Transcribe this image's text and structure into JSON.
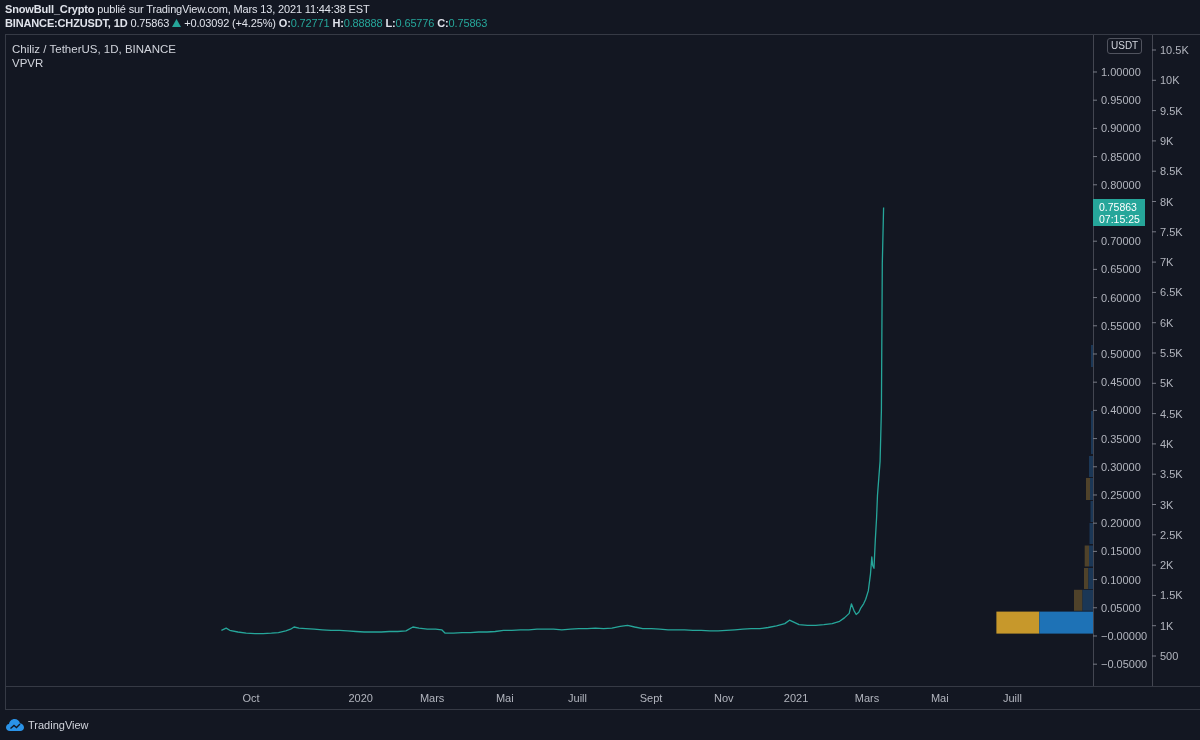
{
  "header": {
    "publisher": "**SnowBull_Crypto** publié sur TradingView.com, Mars 13, 2021 11:44:38 EST",
    "symbol": "BINANCE:CHZUSDT, 1D",
    "last": "0.75863",
    "rising": true,
    "change": "+0.03092 (+4.25%)",
    "ohlc": [
      {
        "label": "O:",
        "value": "0.72771"
      },
      {
        "label": "H:",
        "value": "0.88888"
      },
      {
        "label": "L:",
        "value": "0.65776"
      },
      {
        "label": "C:",
        "value": "0.75863"
      }
    ]
  },
  "legend": {
    "title": "Chiliz / TetherUS, 1D, BINANCE",
    "indicators": [
      "VPVR"
    ]
  },
  "price_chart": {
    "currency": "USDT",
    "last_price": {
      "value": "0.75863",
      "countdown": "07:15:25"
    },
    "chart_data": {
      "type": "line",
      "x": [
        2019.68,
        2019.691,
        2019.699,
        2019.718,
        2019.737,
        2019.757,
        2019.776,
        2019.795,
        2019.811,
        2019.828,
        2019.839,
        2019.847,
        2019.858,
        2019.874,
        2019.893,
        2019.912,
        2019.932,
        2019.951,
        2019.97,
        2019.989,
        2020.008,
        2020.027,
        2020.047,
        2020.066,
        2020.085,
        2020.104,
        2020.12,
        2020.134,
        2020.153,
        2020.172,
        2020.186,
        2020.194,
        2020.213,
        2020.233,
        2020.252,
        2020.271,
        2020.29,
        2020.309,
        2020.328,
        2020.347,
        2020.367,
        2020.386,
        2020.405,
        2020.424,
        2020.443,
        2020.462,
        2020.482,
        2020.501,
        2020.52,
        2020.539,
        2020.558,
        2020.577,
        2020.596,
        2020.613,
        2020.629,
        2020.648,
        2020.668,
        2020.687,
        2020.706,
        2020.725,
        2020.744,
        2020.763,
        2020.782,
        2020.802,
        2020.821,
        2020.84,
        2020.859,
        2020.878,
        2020.897,
        2020.917,
        2020.936,
        2020.955,
        2020.974,
        2020.985,
        2020.996,
        2021.007,
        2021.026,
        2021.045,
        2021.064,
        2021.083,
        2021.1,
        2021.111,
        2021.122,
        2021.127,
        2021.133,
        2021.138,
        2021.144,
        2021.149,
        2021.155,
        2021.16,
        2021.166,
        2021.171,
        2021.174,
        2021.176,
        2021.179,
        2021.182,
        2021.185,
        2021.187,
        2021.19,
        2021.193,
        2021.196,
        2021.198,
        2021.201
      ],
      "values": [
        0.01,
        0.014,
        0.01,
        0.007,
        0.005,
        0.004,
        0.004,
        0.005,
        0.006,
        0.009,
        0.012,
        0.016,
        0.014,
        0.013,
        0.012,
        0.011,
        0.01,
        0.01,
        0.009,
        0.008,
        0.007,
        0.007,
        0.007,
        0.008,
        0.008,
        0.009,
        0.016,
        0.014,
        0.012,
        0.012,
        0.011,
        0.005,
        0.005,
        0.006,
        0.006,
        0.007,
        0.007,
        0.008,
        0.01,
        0.01,
        0.011,
        0.011,
        0.012,
        0.012,
        0.012,
        0.011,
        0.012,
        0.013,
        0.013,
        0.014,
        0.013,
        0.014,
        0.017,
        0.019,
        0.016,
        0.013,
        0.013,
        0.012,
        0.011,
        0.011,
        0.011,
        0.01,
        0.01,
        0.009,
        0.009,
        0.01,
        0.011,
        0.012,
        0.013,
        0.013,
        0.015,
        0.018,
        0.022,
        0.028,
        0.024,
        0.02,
        0.019,
        0.019,
        0.02,
        0.022,
        0.026,
        0.032,
        0.04,
        0.057,
        0.045,
        0.038,
        0.042,
        0.05,
        0.057,
        0.065,
        0.08,
        0.11,
        0.14,
        0.125,
        0.12,
        0.17,
        0.21,
        0.25,
        0.28,
        0.31,
        0.4,
        0.66,
        0.76
      ],
      "xlim": [
        2019.183,
        2021.682
      ],
      "ylim": [
        -0.0887,
        1.0656
      ],
      "xticks": [
        {
          "value": 2019.748,
          "label": "Oct"
        },
        2020,
        {
          "value": 2020.164,
          "label": "Mars"
        },
        {
          "value": 2020.331,
          "label": "Mai"
        },
        {
          "value": 2020.498,
          "label": "Juill"
        },
        {
          "value": 2020.667,
          "label": "Sept"
        },
        {
          "value": 2020.834,
          "label": "Nov"
        },
        2021,
        {
          "value": 2021.163,
          "label": "Mars"
        },
        {
          "value": 2021.33,
          "label": "Mai"
        },
        {
          "value": 2021.497,
          "label": "Juill"
        }
      ],
      "yticks": [
        {
          "value": 1,
          "label": "1.00000"
        },
        {
          "value": 0.95,
          "label": "0.95000"
        },
        {
          "value": 0.9,
          "label": "0.90000"
        },
        {
          "value": 0.85,
          "label": "0.85000"
        },
        {
          "value": 0.8,
          "label": "0.80000"
        },
        {
          "value": 0.7,
          "label": "0.70000"
        },
        {
          "value": 0.65,
          "label": "0.65000"
        },
        {
          "value": 0.6,
          "label": "0.60000"
        },
        {
          "value": 0.55,
          "label": "0.55000"
        },
        {
          "value": 0.5,
          "label": "0.50000"
        },
        {
          "value": 0.45,
          "label": "0.45000"
        },
        {
          "value": 0.4,
          "label": "0.40000"
        },
        {
          "value": 0.35,
          "label": "0.35000"
        },
        {
          "value": 0.3,
          "label": "0.30000"
        },
        {
          "value": 0.25,
          "label": "0.25000"
        },
        {
          "value": 0.2,
          "label": "0.20000"
        },
        {
          "value": 0.15,
          "label": "0.15000"
        },
        {
          "value": 0.1,
          "label": "0.10000"
        },
        {
          "value": 0.05,
          "label": "0.05000"
        },
        {
          "value": 0,
          "label": "−0.00000"
        },
        {
          "value": -0.05,
          "label": "−0.05000"
        }
      ]
    }
  },
  "volume_axis": {
    "ticks": [
      "10.5K",
      "10K",
      "9.5K",
      "9K",
      "8.5K",
      "8K",
      "7.5K",
      "7K",
      "6.5K",
      "6K",
      "5.5K",
      "5K",
      "4.5K",
      "4K",
      "3.5K",
      "3K",
      "2.5K",
      "2K",
      "1.5K",
      "1K",
      "500"
    ]
  },
  "footer": {
    "brand": "TradingView"
  }
}
